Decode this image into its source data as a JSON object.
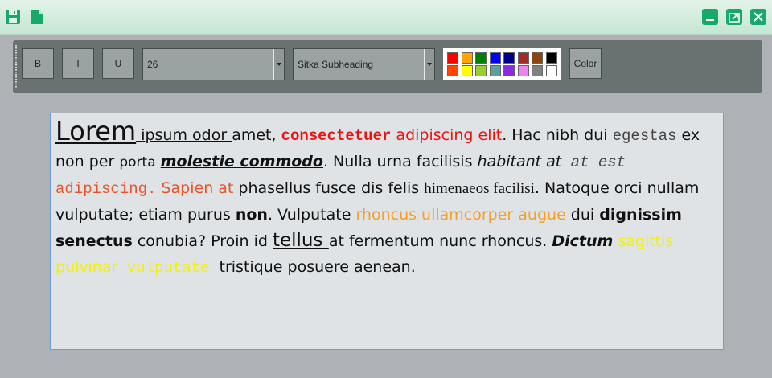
{
  "titlebar": {
    "left_icons": [
      "save-icon",
      "new-document-icon"
    ],
    "right_icons": [
      "minimize-icon",
      "restore-icon",
      "close-icon"
    ],
    "accent": "#17a96a"
  },
  "toolbar": {
    "bold_label": "B",
    "italic_label": "I",
    "underline_label": "U",
    "font_size": "26",
    "font_family": "Sitka Subheading",
    "color_label": "Color",
    "palette_row1": [
      "#ff0000",
      "#ffa500",
      "#008000",
      "#0000ff",
      "#00008b",
      "#a52a2a",
      "#8b4513",
      "#000000"
    ],
    "palette_row2": [
      "#ff4500",
      "#ffff00",
      "#9acd32",
      "#5f9ea0",
      "#8a2be2",
      "#ee82ee",
      "#808080",
      "#ffffff"
    ]
  },
  "editor": {
    "text": {
      "lorem": "Lorem",
      "ipsum_odor": " ipsum odor ",
      "amet": "amet, ",
      "consectetuer": "consectetuer",
      "adipiscing_elit": " adipiscing elit",
      "hac": ". Hac nibh dui ",
      "egestas": "egestas",
      "ex_non_per": " ex non per ",
      "porta": "porta",
      "molestie": "molestie commodo",
      "nulla_urna": ". Nulla urna facilisis ",
      "habitant_at": "habitant at",
      "at_est": " at est",
      "adipiscing2": "adipiscing.",
      "sapien_at": " Sapien at",
      "phasellus": " phasellus fusce dis felis ",
      "himenaeos": "himenaeos facilisi",
      "natoque": ". Natoque orci nullam vulputate; etiam purus ",
      "non": "non",
      "vulputate": ". Vulputate ",
      "rhoncus": "rhoncus ullamcorper augue",
      "dui": " dui ",
      "dignissim": "dignissim senectus",
      "conubia": " conubia? Proin id ",
      "tellus": "tellus ",
      "fermentum": "at fermentum nunc rhoncus. ",
      "dictum": "Dictum",
      "sagittis": " sagittis pulvinar",
      "vulputate2": " vulputate",
      "tristique": "  tristique ",
      "posuere": "posuere aenean",
      "period": "."
    },
    "colors": {
      "red": "#ee1111",
      "orange_red": "#e8532a",
      "orange": "#f5a025",
      "yellow": "#f2f200"
    }
  }
}
